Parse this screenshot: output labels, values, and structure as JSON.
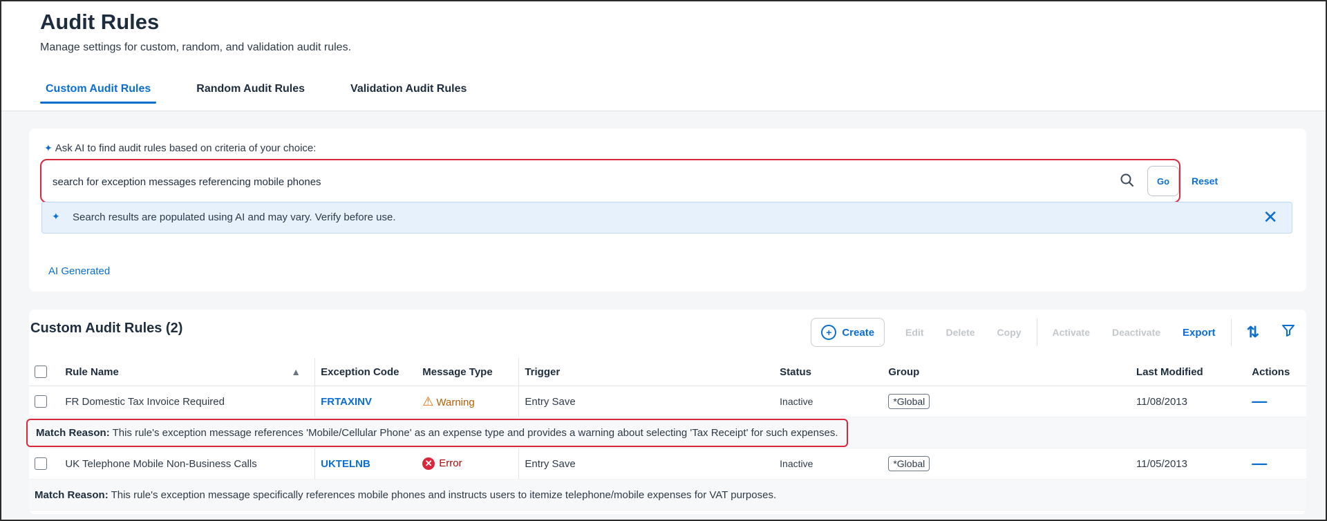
{
  "header": {
    "title": "Audit Rules",
    "subtitle": "Manage settings for custom, random, and validation audit rules.",
    "tabs": [
      {
        "label": "Custom Audit Rules",
        "active": true
      },
      {
        "label": "Random Audit Rules",
        "active": false
      },
      {
        "label": "Validation Audit Rules",
        "active": false
      }
    ]
  },
  "ai_search": {
    "label": "Ask AI to find audit rules based on criteria of your choice:",
    "query": "search for exception messages referencing mobile phones",
    "go_label": "Go",
    "reset_label": "Reset",
    "info_message": "Search results are populated using AI and may vary. Verify before use.",
    "ai_generated_label": "AI Generated"
  },
  "table": {
    "title": "Custom Audit Rules (2)",
    "toolbar": {
      "create": "Create",
      "edit": "Edit",
      "delete": "Delete",
      "copy": "Copy",
      "activate": "Activate",
      "deactivate": "Deactivate",
      "export": "Export"
    },
    "columns": [
      "Rule Name",
      "Exception Code",
      "Message Type",
      "Trigger",
      "Status",
      "Group",
      "Last Modified",
      "Actions"
    ],
    "match_label": "Match Reason:",
    "rows": [
      {
        "rule_name": "FR Domestic Tax Invoice Required",
        "exception_code": "FRTAXINV",
        "message_type": "Warning",
        "trigger": "Entry Save",
        "status": "Inactive",
        "group": "*Global",
        "last_modified": "11/08/2013",
        "match_reason": "This rule's exception message references 'Mobile/Cellular Phone' as an expense type and provides a warning about selecting 'Tax Receipt' for such expenses."
      },
      {
        "rule_name": "UK Telephone Mobile Non-Business Calls",
        "exception_code": "UKTELNB",
        "message_type": "Error",
        "trigger": "Entry Save",
        "status": "Inactive",
        "group": "*Global",
        "last_modified": "11/05/2013",
        "match_reason": "This rule's exception message specifically references mobile phones and instructs users to itemize telephone/mobile expenses for VAT purposes."
      }
    ]
  },
  "colors": {
    "accent": "#0a6ed1",
    "highlight_border": "#d9263d",
    "warning": "#e76500",
    "error": "#d9263d",
    "info_bg": "#e6f1fb"
  },
  "icons": {
    "search": "search-icon",
    "sparkle": "ai-sparkle-icon",
    "close": "close-icon",
    "create": "plus-circle-icon",
    "sort": "sort-icon",
    "filter": "filter-icon",
    "warning": "warning-triangle-icon",
    "error": "error-circle-icon",
    "actions": "more-dash-icon"
  }
}
